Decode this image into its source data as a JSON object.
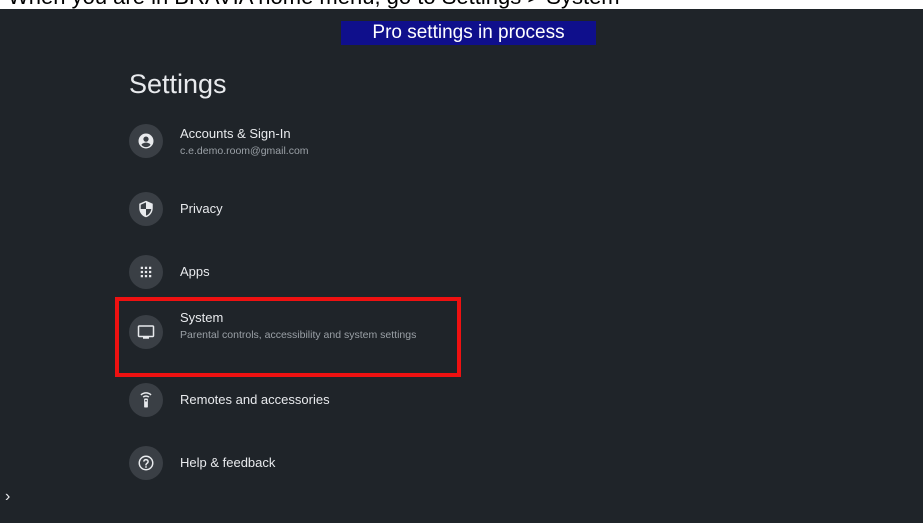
{
  "instruction": "When you are in BRAVIA home menu, go to Settings > System",
  "banner": "Pro settings in process",
  "settings": {
    "title": "Settings",
    "items": [
      {
        "label": "Accounts & Sign-In",
        "sub": "c.e.demo.room@gmail.com",
        "icon": "account-circle-icon"
      },
      {
        "label": "Privacy",
        "sub": "",
        "icon": "shield-icon"
      },
      {
        "label": "Apps",
        "sub": "",
        "icon": "apps-grid-icon"
      },
      {
        "label": "System",
        "sub": "Parental controls, accessibility and system settings",
        "icon": "tv-monitor-icon",
        "highlighted": true
      },
      {
        "label": "Remotes and accessories",
        "sub": "",
        "icon": "remote-icon"
      },
      {
        "label": "Help & feedback",
        "sub": "",
        "icon": "help-icon"
      }
    ]
  },
  "side_arrow": "›",
  "colors": {
    "background": "#1f2429",
    "banner": "#0f0f8c",
    "highlight": "#ee1111",
    "text": "#e8eaed",
    "subtext": "#9aa0a6"
  }
}
